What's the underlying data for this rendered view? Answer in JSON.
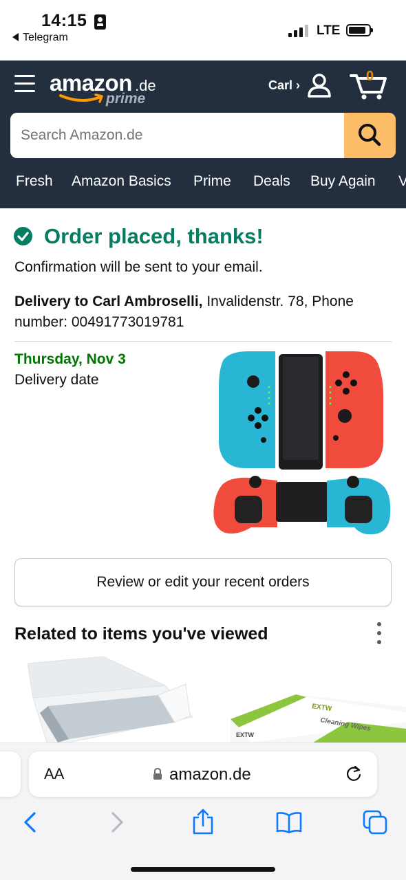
{
  "status_bar": {
    "time": "14:15",
    "back_app": "Telegram",
    "network": "LTE",
    "icons": [
      "id-card-icon",
      "signal-icon",
      "battery-icon"
    ]
  },
  "header": {
    "logo_word": "amazon",
    "logo_tld": ".de",
    "logo_sub": "prime",
    "account_label": "Carl ›",
    "cart_count": "0",
    "search_placeholder": "Search Amazon.de",
    "nav_links": [
      "Fresh",
      "Amazon Basics",
      "Prime",
      "Deals",
      "Buy Again",
      "V"
    ],
    "colors": {
      "header_bg": "#232f3e",
      "search_button": "#febd69",
      "cart_count": "#f08804"
    }
  },
  "order": {
    "title": "Order placed, thanks!",
    "confirmation": "Confirmation will be sent to your email.",
    "delivery_name": "Delivery to Carl Ambroselli,",
    "delivery_address": " Invalidenstr. 78, Phone number: 00491773019781",
    "delivery_date": "Thursday, Nov 3",
    "delivery_date_label": "Delivery date",
    "colors": {
      "success": "#067d62",
      "date": "#007600"
    }
  },
  "actions": {
    "review_orders": "Review or edit your recent orders"
  },
  "related": {
    "heading": "Related to items you've viewed",
    "product_brand": "EXTW",
    "product_text": "Cleaning Wipes"
  },
  "browser": {
    "text_size_label": "AA",
    "domain": "amazon.de",
    "toolbar_icons": [
      "back-icon",
      "forward-icon",
      "share-icon",
      "bookmarks-icon",
      "tabs-icon"
    ],
    "accent": "#0a7aff"
  }
}
